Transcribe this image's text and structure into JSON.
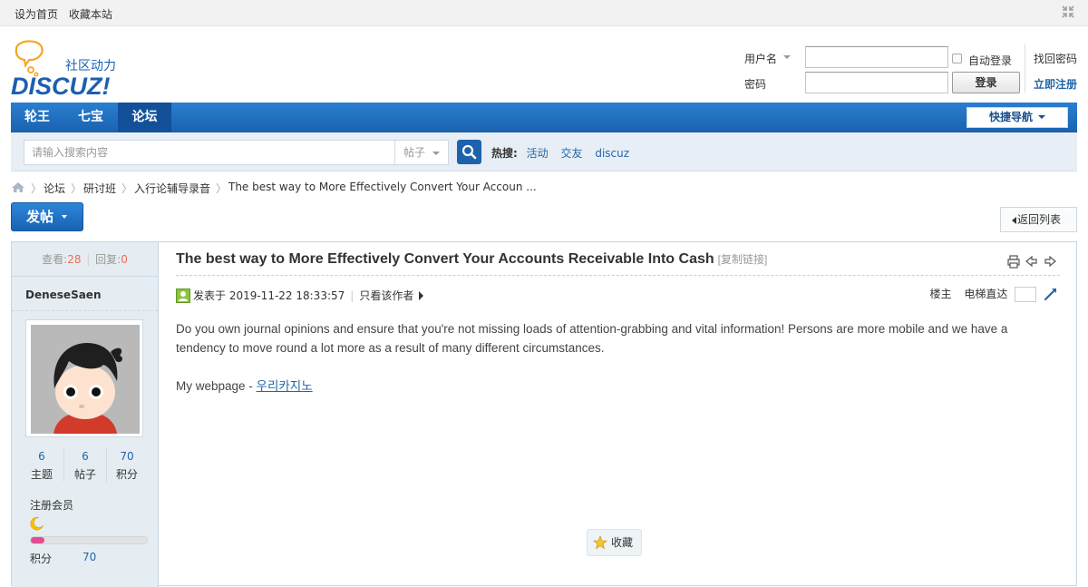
{
  "topbar": {
    "links": [
      "设为首页",
      "收藏本站"
    ]
  },
  "logo": {
    "tagline": "社区动力",
    "brand": "DISCUZ!"
  },
  "login": {
    "username_label": "用户名",
    "password_label": "密码",
    "auto_login": "自动登录",
    "login_button": "登录",
    "forgot": "找回密码",
    "register": "立即注册"
  },
  "nav": {
    "items": [
      {
        "label": "轮王",
        "active": false
      },
      {
        "label": "七宝",
        "active": false
      },
      {
        "label": "论坛",
        "active": true
      }
    ],
    "quick": "快捷导航"
  },
  "search": {
    "placeholder": "请输入搜索内容",
    "scope": "帖子",
    "hot_label": "热搜:",
    "hot": [
      "活动",
      "交友",
      "discuz"
    ]
  },
  "breadcrumb": [
    "论坛",
    "研讨班",
    "入行论辅导录音",
    "The best way to More Effectively Convert Your Accoun ..."
  ],
  "actions": {
    "post": "发帖",
    "back": "返回列表"
  },
  "sidebar": {
    "views_label": "查看:",
    "views": "28",
    "replies_label": "回复:",
    "replies": "0",
    "username": "DeneseSaen",
    "counts": [
      {
        "value": "6",
        "label": "主题"
      },
      {
        "value": "6",
        "label": "帖子"
      },
      {
        "value": "70",
        "label": "积分"
      }
    ],
    "group": "注册会员",
    "progress": 0.12,
    "points_label": "积分",
    "points": "70"
  },
  "post": {
    "title": "The best way to More Effectively Convert Your Accounts Receivable Into Cash",
    "copy_link": "[复制链接]",
    "posted": "发表于 2019-11-22 18:33:57",
    "author_only": "只看该作者",
    "floor": "楼主",
    "jump_label": "电梯直达",
    "body1": "Do you own journal opinions and ensure that you're not missing loads of attention-grabbing and vital information! Persons are more mobile and we have a tendency to move round a lot more as a result of many different circumstances.",
    "body2_prefix": "My webpage - ",
    "body2_link": "우리카지노",
    "favorite": "收藏"
  },
  "colors": {
    "nav_blue": "#1a63b0",
    "link_blue": "#2366a8",
    "count_red": "#f26c4f",
    "sidebar_bg": "#e5edf2"
  }
}
